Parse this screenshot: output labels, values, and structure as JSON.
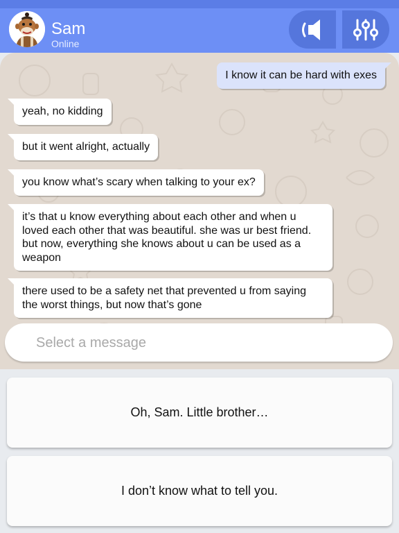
{
  "contact": {
    "name": "Sam",
    "status": "Online",
    "avatar": "sock-monkey-avatar"
  },
  "header": {
    "sound_icon": "speaker-icon",
    "settings_icon": "sliders-icon"
  },
  "messages": [
    {
      "from": "me",
      "text": "I know it can be hard with exes"
    },
    {
      "from": "Sam",
      "text": "yeah, no kidding"
    },
    {
      "from": "Sam",
      "text": "but it went alright, actually"
    },
    {
      "from": "Sam",
      "text": "you know what’s scary when talking to your ex?"
    },
    {
      "from": "Sam",
      "text": "it’s that u know everything about each other and when u loved each other that was beautiful. she was ur best friend. but now, everything she knows about u can be used as a weapon"
    },
    {
      "from": "Sam",
      "text": "there used to be a safety net that prevented u from saying the worst things, but now that’s gone"
    }
  ],
  "input": {
    "placeholder": "Select a message"
  },
  "choices": [
    {
      "label": "Oh, Sam. Little brother…"
    },
    {
      "label": "I don’t know what to tell you."
    }
  ],
  "colors": {
    "header": "#6d8ff5",
    "header_button": "#5576dc",
    "chat_background": "#e2d9d0",
    "outgoing_bubble": "#dbe3fb",
    "incoming_bubble": "#ffffff"
  }
}
